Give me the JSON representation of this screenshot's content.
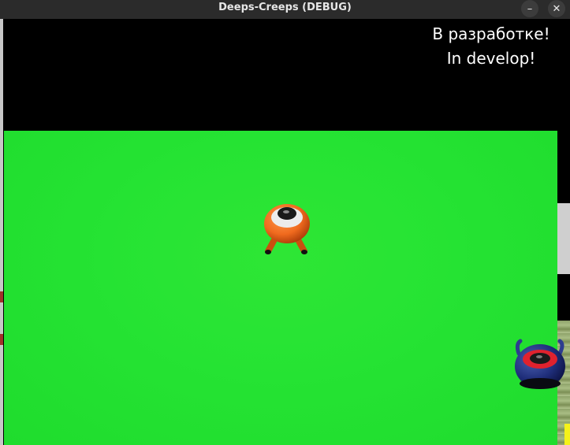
{
  "window": {
    "title": "Deeps-Creeps (DEBUG)",
    "minimize_symbol": "–",
    "close_symbol": "✕"
  },
  "hud": {
    "line1": "В разработке!",
    "line2": "In develop!"
  },
  "scene": {
    "ground_color": "#25e333",
    "creeps": [
      {
        "name": "orange-creep",
        "color": "#f06a1e"
      },
      {
        "name": "blue-creep",
        "color": "#1f2e7a"
      }
    ]
  }
}
